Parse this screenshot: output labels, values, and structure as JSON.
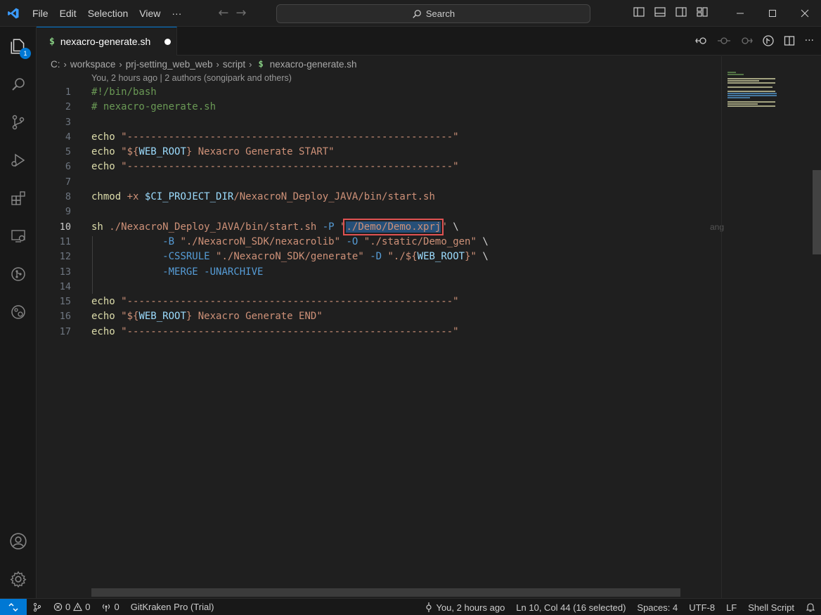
{
  "titlebar": {
    "menu": [
      "File",
      "Edit",
      "Selection",
      "View",
      "···"
    ],
    "search_placeholder": "Search"
  },
  "activity": {
    "explorer_badge": "1",
    "items": [
      "files-icon",
      "search-icon",
      "source-control-icon",
      "run-debug-icon",
      "extensions-icon",
      "remote-explorer-icon",
      "gitkraken-icon",
      "gitlens-icon"
    ],
    "bottom": [
      "account-icon",
      "settings-gear-icon"
    ]
  },
  "tab": {
    "icon": "$",
    "label": "nexacro-generate.sh",
    "modified": true
  },
  "breadcrumb": {
    "items": [
      "C:",
      "workspace",
      "prj-setting_web_web",
      "script"
    ],
    "file_icon": "$",
    "file": "nexacro-generate.sh"
  },
  "lens": "You, 2 hours ago | 2 authors (songipark and others)",
  "editor": {
    "active_line": "10",
    "lines": [
      {
        "n": "1",
        "t": [
          [
            "c-comment",
            "#!/bin/bash"
          ]
        ]
      },
      {
        "n": "2",
        "t": [
          [
            "c-comment",
            "# nexacro-generate.sh"
          ]
        ]
      },
      {
        "n": "3",
        "t": []
      },
      {
        "n": "4",
        "t": [
          [
            "c-yel",
            "echo"
          ],
          [
            "c-plain",
            " "
          ],
          [
            "c-str",
            "\"-------------------------------------------------------\""
          ]
        ]
      },
      {
        "n": "5",
        "t": [
          [
            "c-yel",
            "echo"
          ],
          [
            "c-plain",
            " "
          ],
          [
            "c-str",
            "\"${"
          ],
          [
            "c-var",
            "WEB_ROOT"
          ],
          [
            "c-str",
            "} Nexacro Generate START\""
          ]
        ]
      },
      {
        "n": "6",
        "t": [
          [
            "c-yel",
            "echo"
          ],
          [
            "c-plain",
            " "
          ],
          [
            "c-str",
            "\"-------------------------------------------------------\""
          ]
        ]
      },
      {
        "n": "7",
        "t": []
      },
      {
        "n": "8",
        "t": [
          [
            "c-yel",
            "chmod"
          ],
          [
            "c-plain",
            " "
          ],
          [
            "c-str",
            "+x"
          ],
          [
            "c-plain",
            " "
          ],
          [
            "c-var",
            "$CI_PROJECT_DIR"
          ],
          [
            "c-str",
            "/NexacroN_Deploy_JAVA/bin/start.sh"
          ]
        ]
      },
      {
        "n": "9",
        "t": []
      },
      {
        "n": "10",
        "t": [
          [
            "c-yel",
            "sh"
          ],
          [
            "c-plain",
            " "
          ],
          [
            "c-str",
            "./NexacroN_Deploy_JAVA/bin/start.sh"
          ],
          [
            "c-plain",
            " "
          ],
          [
            "c-flag",
            "-P"
          ],
          [
            "c-plain",
            " "
          ],
          [
            "c-str",
            "\""
          ],
          [
            "selection",
            "./Demo/Demo.xprj"
          ],
          [
            "c-str",
            "\""
          ],
          [
            "c-plain",
            " \\"
          ]
        ]
      },
      {
        "n": "11",
        "t": [
          [
            "c-plain",
            "            "
          ],
          [
            "c-flag",
            "-B"
          ],
          [
            "c-plain",
            " "
          ],
          [
            "c-str",
            "\"./NexacroN_SDK/nexacrolib\""
          ],
          [
            "c-plain",
            " "
          ],
          [
            "c-flag",
            "-O"
          ],
          [
            "c-plain",
            " "
          ],
          [
            "c-str",
            "\"./static/Demo_gen\""
          ],
          [
            "c-plain",
            " \\"
          ]
        ]
      },
      {
        "n": "12",
        "t": [
          [
            "c-plain",
            "            "
          ],
          [
            "c-flag",
            "-CSSRULE"
          ],
          [
            "c-plain",
            " "
          ],
          [
            "c-str",
            "\"./NexacroN_SDK/generate\""
          ],
          [
            "c-plain",
            " "
          ],
          [
            "c-flag",
            "-D"
          ],
          [
            "c-plain",
            " "
          ],
          [
            "c-str",
            "\"./${"
          ],
          [
            "c-var",
            "WEB_ROOT"
          ],
          [
            "c-str",
            "}\""
          ],
          [
            "c-plain",
            " \\"
          ]
        ]
      },
      {
        "n": "13",
        "t": [
          [
            "c-plain",
            "            "
          ],
          [
            "c-flag",
            "-MERGE"
          ],
          [
            "c-plain",
            " "
          ],
          [
            "c-flag",
            "-UNARCHIVE"
          ]
        ]
      },
      {
        "n": "14",
        "t": []
      },
      {
        "n": "15",
        "t": [
          [
            "c-yel",
            "echo"
          ],
          [
            "c-plain",
            " "
          ],
          [
            "c-str",
            "\"-------------------------------------------------------\""
          ]
        ]
      },
      {
        "n": "16",
        "t": [
          [
            "c-yel",
            "echo"
          ],
          [
            "c-plain",
            " "
          ],
          [
            "c-str",
            "\"${"
          ],
          [
            "c-var",
            "WEB_ROOT"
          ],
          [
            "c-str",
            "} Nexacro Generate END\""
          ]
        ]
      },
      {
        "n": "17",
        "t": [
          [
            "c-yel",
            "echo"
          ],
          [
            "c-plain",
            " "
          ],
          [
            "c-str",
            "\"-------------------------------------------------------\""
          ]
        ]
      }
    ]
  },
  "statusbar": {
    "errors": "0",
    "warnings": "0",
    "ports": "0",
    "gitkraken": "GitKraken Pro (Trial)",
    "blame": "You, 2 hours ago",
    "cursor": "Ln 10, Col 44 (16 selected)",
    "spaces": "Spaces: 4",
    "encoding": "UTF-8",
    "eol": "LF",
    "language": "Shell Script"
  },
  "colors": {
    "accent": "#0078d4",
    "string": "#ce9178",
    "keyword_flag": "#569cd6",
    "variable": "#9cdcfe",
    "comment": "#6a9955",
    "highlight_box": "#e05252"
  }
}
